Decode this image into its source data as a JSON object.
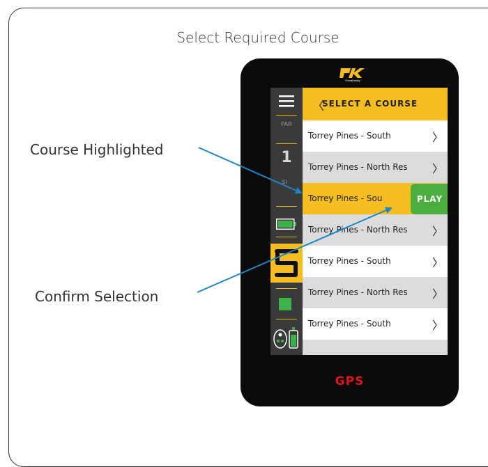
{
  "page": {
    "title": "Select Required Course"
  },
  "callouts": {
    "highlighted": "Course Highlighted",
    "confirm": "Confirm Selection"
  },
  "device": {
    "brand": "PowaKaddy",
    "footer_label": "GPS"
  },
  "sidebar": {
    "par_label": "PAR",
    "hole_number": "1",
    "si_label": "SI"
  },
  "header": {
    "title": "SELECT A COURSE"
  },
  "courses": [
    {
      "label": "Torrey Pines - South",
      "state": "normal"
    },
    {
      "label": "Torrey Pines - North Res",
      "state": "normal"
    },
    {
      "label": "Torrey Pines - Sou",
      "state": "selected"
    },
    {
      "label": "Torrey Pines - North Res",
      "state": "normal"
    },
    {
      "label": "Torrey Pines - South",
      "state": "normal"
    },
    {
      "label": "Torrey Pines - North Res",
      "state": "normal"
    },
    {
      "label": "Torrey Pines - South",
      "state": "normal"
    }
  ],
  "play_button": {
    "label": "PLAY"
  },
  "colors": {
    "accent_yellow": "#f5bd1f",
    "play_green": "#4aae3e",
    "arrow_blue": "#1a86c8",
    "gps_red": "#e0141e"
  },
  "icons": [
    "menu-icon",
    "battery-icon",
    "five-digit-icon",
    "green-square-icon",
    "controller-icon",
    "chevron-left-icon",
    "chevron-right-icon"
  ]
}
